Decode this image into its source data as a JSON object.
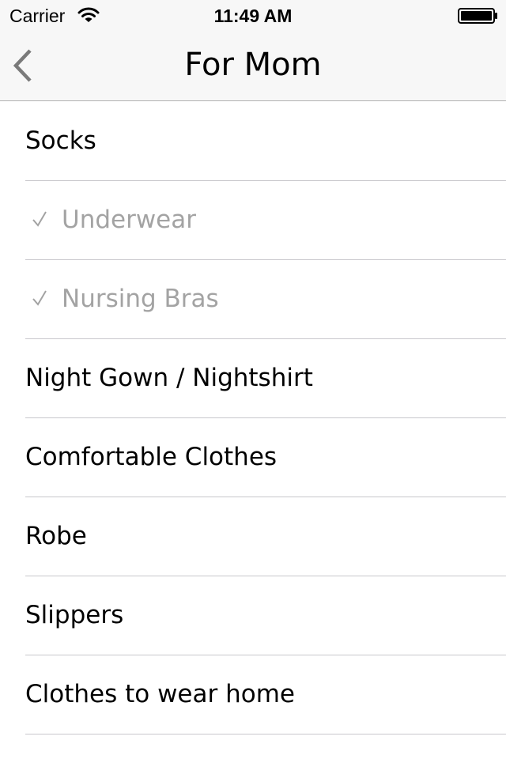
{
  "status_bar": {
    "carrier": "Carrier",
    "time": "11:49 AM",
    "signal_icon": "wifi-icon",
    "battery_icon": "battery-icon"
  },
  "nav": {
    "title": "For Mom",
    "back_icon": "chevron-left-icon"
  },
  "colors": {
    "bar_background": "#f7f7f7",
    "separator": "#c8c7cc",
    "checked_text": "#a3a3a3",
    "text": "#000000"
  },
  "items": [
    {
      "label": "Socks",
      "checked": false
    },
    {
      "label": "Underwear",
      "checked": true
    },
    {
      "label": "Nursing Bras",
      "checked": true
    },
    {
      "label": "Night Gown / Nightshirt",
      "checked": false
    },
    {
      "label": "Comfortable Clothes",
      "checked": false
    },
    {
      "label": "Robe",
      "checked": false
    },
    {
      "label": "Slippers",
      "checked": false
    },
    {
      "label": "Clothes to wear home",
      "checked": false
    }
  ]
}
